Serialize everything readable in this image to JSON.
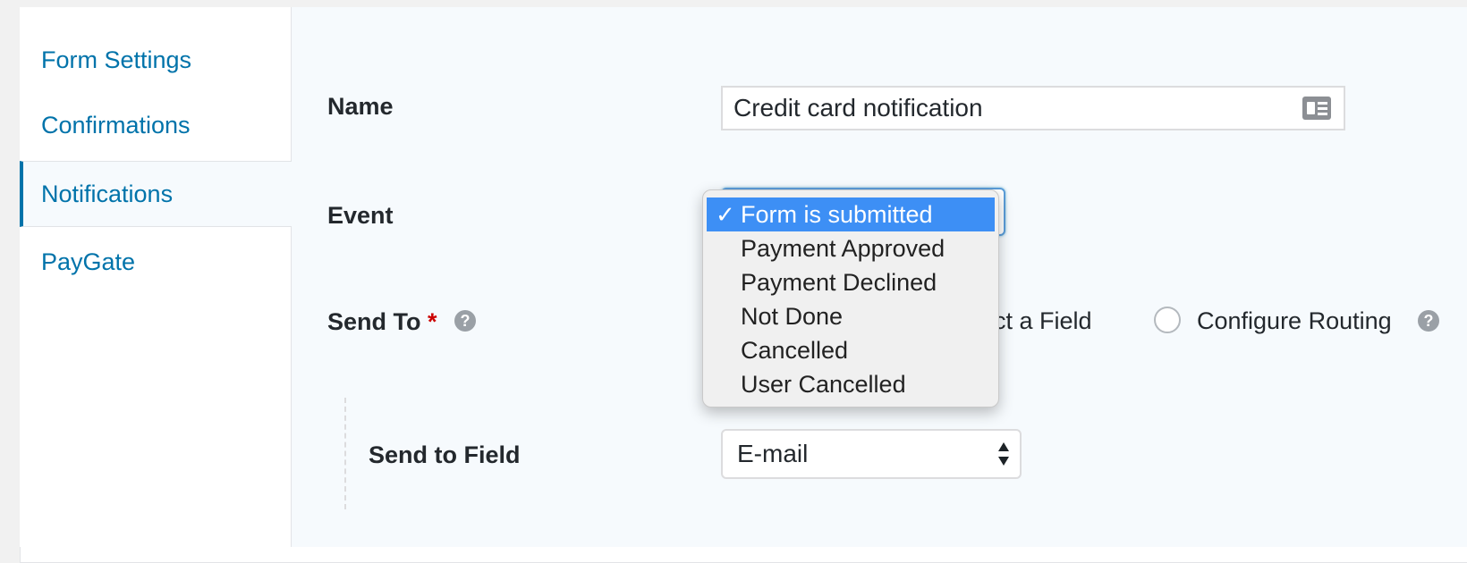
{
  "sidebar": {
    "items": [
      {
        "label": "Form Settings"
      },
      {
        "label": "Confirmations"
      },
      {
        "label": "Notifications",
        "active": true
      },
      {
        "label": "PayGate"
      }
    ]
  },
  "form": {
    "name_label": "Name",
    "name_value": "Credit card notification",
    "event_label": "Event",
    "send_to_label": "Send To",
    "required_mark": "*",
    "send_to_options": {
      "select_field_partial": "lect a Field",
      "configure_routing": "Configure Routing"
    },
    "send_to_field_label": "Send to Field",
    "send_to_field_value": "E-mail"
  },
  "event_dropdown": {
    "check_glyph": "✓",
    "options": [
      {
        "label": "Form is submitted",
        "selected": true
      },
      {
        "label": "Payment Approved"
      },
      {
        "label": "Payment Declined"
      },
      {
        "label": "Not Done"
      },
      {
        "label": "Cancelled"
      },
      {
        "label": "User Cancelled"
      }
    ]
  },
  "icons": {
    "help": "?"
  },
  "colors": {
    "link": "#0073aa",
    "selection": "#3d8ff5",
    "required": "#cc0000"
  }
}
